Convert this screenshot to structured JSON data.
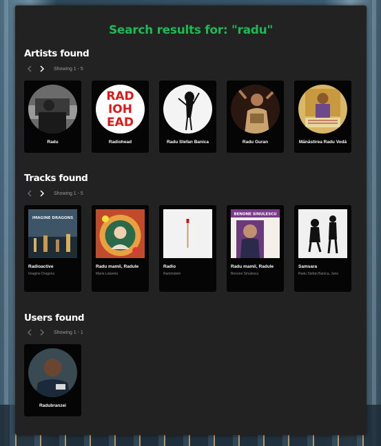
{
  "search": {
    "title": "Search results for: \"radu\""
  },
  "artists": {
    "heading": "Artists found",
    "showing": "Showing 1 - 5",
    "items": [
      {
        "name": "Radu"
      },
      {
        "name": "Radiohead"
      },
      {
        "name": "Radu Stefan Banica"
      },
      {
        "name": "Radu Guran"
      },
      {
        "name": "Mănăstirea Radu Vodă"
      }
    ]
  },
  "tracks": {
    "heading": "Tracks found",
    "showing": "Showing 1 - 5",
    "items": [
      {
        "title": "Radioactive",
        "artist": "Imagine Dragons"
      },
      {
        "title": "Radu mamii, Radule",
        "artist": "Maria Lataretu"
      },
      {
        "title": "Radio",
        "artist": "Rammstein"
      },
      {
        "title": "Radu mamii, Radule",
        "artist": "Benone Sinulescu"
      },
      {
        "title": "Samsara",
        "artist": "Radu Stefan Banica, Juno"
      }
    ]
  },
  "users": {
    "heading": "Users found",
    "showing": "Showing 1 - 1",
    "items": [
      {
        "name": "Radubranzei"
      }
    ]
  },
  "artwork_text": {
    "radiohead": [
      "RAD",
      "IOH",
      "EAD"
    ],
    "imagine_dragons": "IMAGINE DRAGONS",
    "benone": "BENONE SINULESCU"
  },
  "colors": {
    "accent": "#1db954",
    "panel": "#222222",
    "card": "#050505"
  }
}
